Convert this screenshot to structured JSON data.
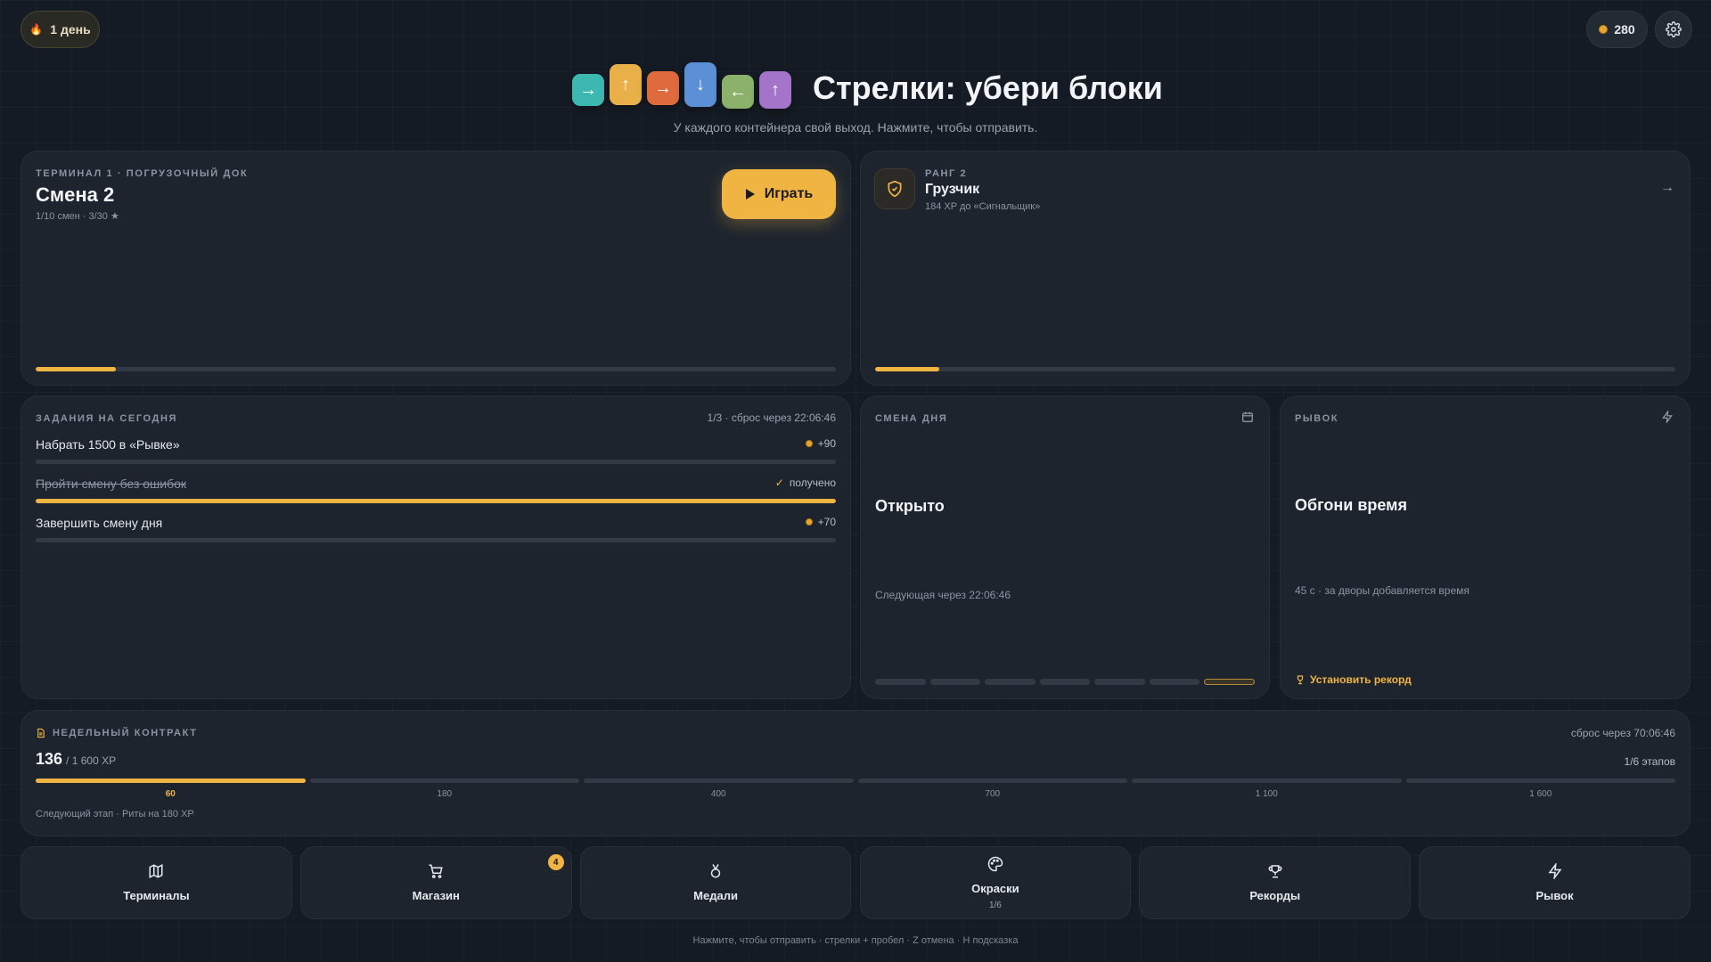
{
  "header": {
    "streak_label": "1 день",
    "coins": "280",
    "title": "Стрелки: убери блоки",
    "subtitle": "У каждого контейнера свой выход. Нажмите, чтобы отправить.",
    "logo_tiles": [
      {
        "arrow": "→",
        "color": "#3db8b0"
      },
      {
        "arrow": "↑",
        "color": "#e9b04a"
      },
      {
        "arrow": "→",
        "color": "#de6a3e"
      },
      {
        "arrow": "↓",
        "color": "#5b8fd6"
      },
      {
        "arrow": "←",
        "color": "#8bb16a"
      },
      {
        "arrow": "↑",
        "color": "#a374c9"
      }
    ]
  },
  "terminal": {
    "caption": "ТЕРМИНАЛ 1 · ПОГРУЗОЧНЫЙ ДОК",
    "title": "Смена 2",
    "meta": "1/10 смен · 3/30 ★",
    "play_label": "Играть",
    "progress": 0.1
  },
  "rank": {
    "caption": "РАНГ 2",
    "title": "Грузчик",
    "meta": "184 XP до «Сигнальщик»",
    "progress": 0.08
  },
  "tasks": {
    "caption": "ЗАДАНИЯ НА СЕГОДНЯ",
    "status": "1/3 · сброс через 22:06:46",
    "items": [
      {
        "label": "Набрать 1500 в «Рывке»",
        "reward": "+90",
        "done": false,
        "progress": 0
      },
      {
        "label": "Пройти смену без ошибок",
        "reward": "получено",
        "done": true,
        "progress": 1
      },
      {
        "label": "Завершить смену дня",
        "reward": "+70",
        "done": false,
        "progress": 0
      }
    ]
  },
  "daily": {
    "caption": "СМЕНА ДНЯ",
    "status": "Открыто",
    "next": "Следующая через 22:06:46",
    "days_total": 7,
    "current_day": 7
  },
  "rush": {
    "caption": "РЫВОК",
    "title": "Обгони время",
    "meta": "45 с · за дворы добавляется время",
    "action": "Установить рекорд"
  },
  "contract": {
    "caption": "НЕДЕЛЬНЫЙ КОНТРАКТ",
    "reset": "сброс через 70:06:46",
    "xp_value": "136",
    "xp_total": "/ 1 600 XP",
    "stages": "1/6 этапов",
    "milestones": [
      "60",
      "180",
      "400",
      "700",
      "1 100",
      "1 600"
    ],
    "completed_stages": 1,
    "next_stage": "Следующий этап · Риты на 180 XP"
  },
  "nav": [
    {
      "label": "Терминалы",
      "icon": "map-icon"
    },
    {
      "label": "Магазин",
      "icon": "cart-icon",
      "badge": "4"
    },
    {
      "label": "Медали",
      "icon": "medal-icon"
    },
    {
      "label": "Окраски",
      "icon": "palette-icon",
      "sub": "1/6"
    },
    {
      "label": "Рекорды",
      "icon": "trophy-icon"
    },
    {
      "label": "Рывок",
      "icon": "bolt-icon"
    }
  ],
  "footer": "Нажмите, чтобы отправить · стрелки + пробел · Z отмена · H подсказка",
  "colors": {
    "accent": "#f0b443",
    "background": "#151b24",
    "card": "#1d242e"
  }
}
